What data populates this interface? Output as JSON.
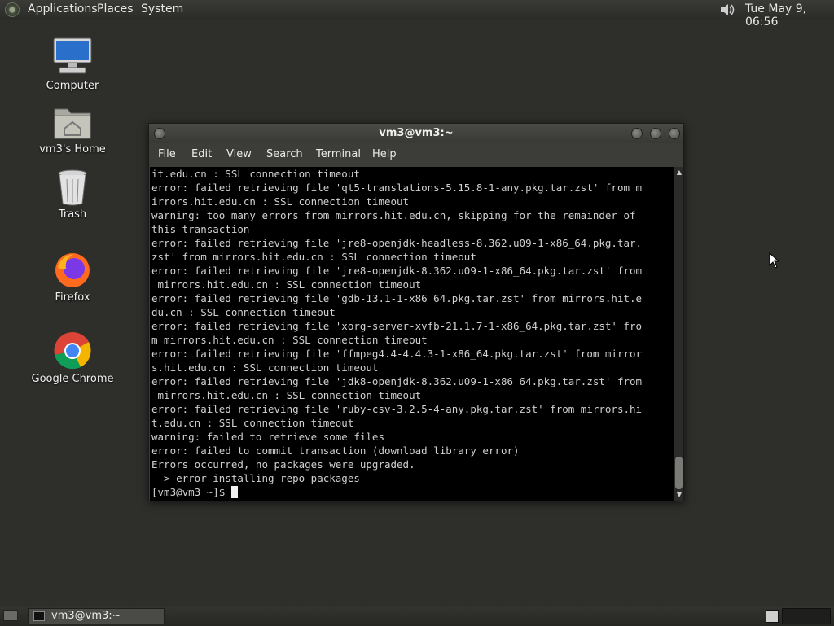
{
  "top_panel": {
    "menus": [
      "Applications",
      "Places",
      "System"
    ],
    "clock": "Tue May  9, 06:56",
    "volume_icon": "speaker-icon"
  },
  "desktop_icons": [
    {
      "label": "Computer",
      "icon": "computer-icon"
    },
    {
      "label": "vm3's Home",
      "icon": "home-folder-icon"
    },
    {
      "label": "Trash",
      "icon": "trash-icon"
    },
    {
      "label": "Firefox",
      "icon": "firefox-icon"
    },
    {
      "label": "Google Chrome",
      "icon": "chrome-icon"
    }
  ],
  "window": {
    "title": "vm3@vm3:~",
    "menu": [
      "File",
      "Edit",
      "View",
      "Search",
      "Terminal",
      "Help"
    ],
    "terminal_lines": [
      "it.edu.cn : SSL connection timeout",
      "error: failed retrieving file 'qt5-translations-5.15.8-1-any.pkg.tar.zst' from m",
      "irrors.hit.edu.cn : SSL connection timeout",
      "warning: too many errors from mirrors.hit.edu.cn, skipping for the remainder of",
      "this transaction",
      "error: failed retrieving file 'jre8-openjdk-headless-8.362.u09-1-x86_64.pkg.tar.",
      "zst' from mirrors.hit.edu.cn : SSL connection timeout",
      "error: failed retrieving file 'jre8-openjdk-8.362.u09-1-x86_64.pkg.tar.zst' from",
      " mirrors.hit.edu.cn : SSL connection timeout",
      "error: failed retrieving file 'gdb-13.1-1-x86_64.pkg.tar.zst' from mirrors.hit.e",
      "du.cn : SSL connection timeout",
      "error: failed retrieving file 'xorg-server-xvfb-21.1.7-1-x86_64.pkg.tar.zst' fro",
      "m mirrors.hit.edu.cn : SSL connection timeout",
      "error: failed retrieving file 'ffmpeg4.4-4.4.3-1-x86_64.pkg.tar.zst' from mirror",
      "s.hit.edu.cn : SSL connection timeout",
      "error: failed retrieving file 'jdk8-openjdk-8.362.u09-1-x86_64.pkg.tar.zst' from",
      " mirrors.hit.edu.cn : SSL connection timeout",
      "error: failed retrieving file 'ruby-csv-3.2.5-4-any.pkg.tar.zst' from mirrors.hi",
      "t.edu.cn : SSL connection timeout",
      "warning: failed to retrieve some files",
      "error: failed to commit transaction (download library error)",
      "Errors occurred, no packages were upgraded.",
      " -> error installing repo packages"
    ],
    "prompt": "[vm3@vm3 ~]$ "
  },
  "taskbar": {
    "task_label": "vm3@vm3:~"
  }
}
